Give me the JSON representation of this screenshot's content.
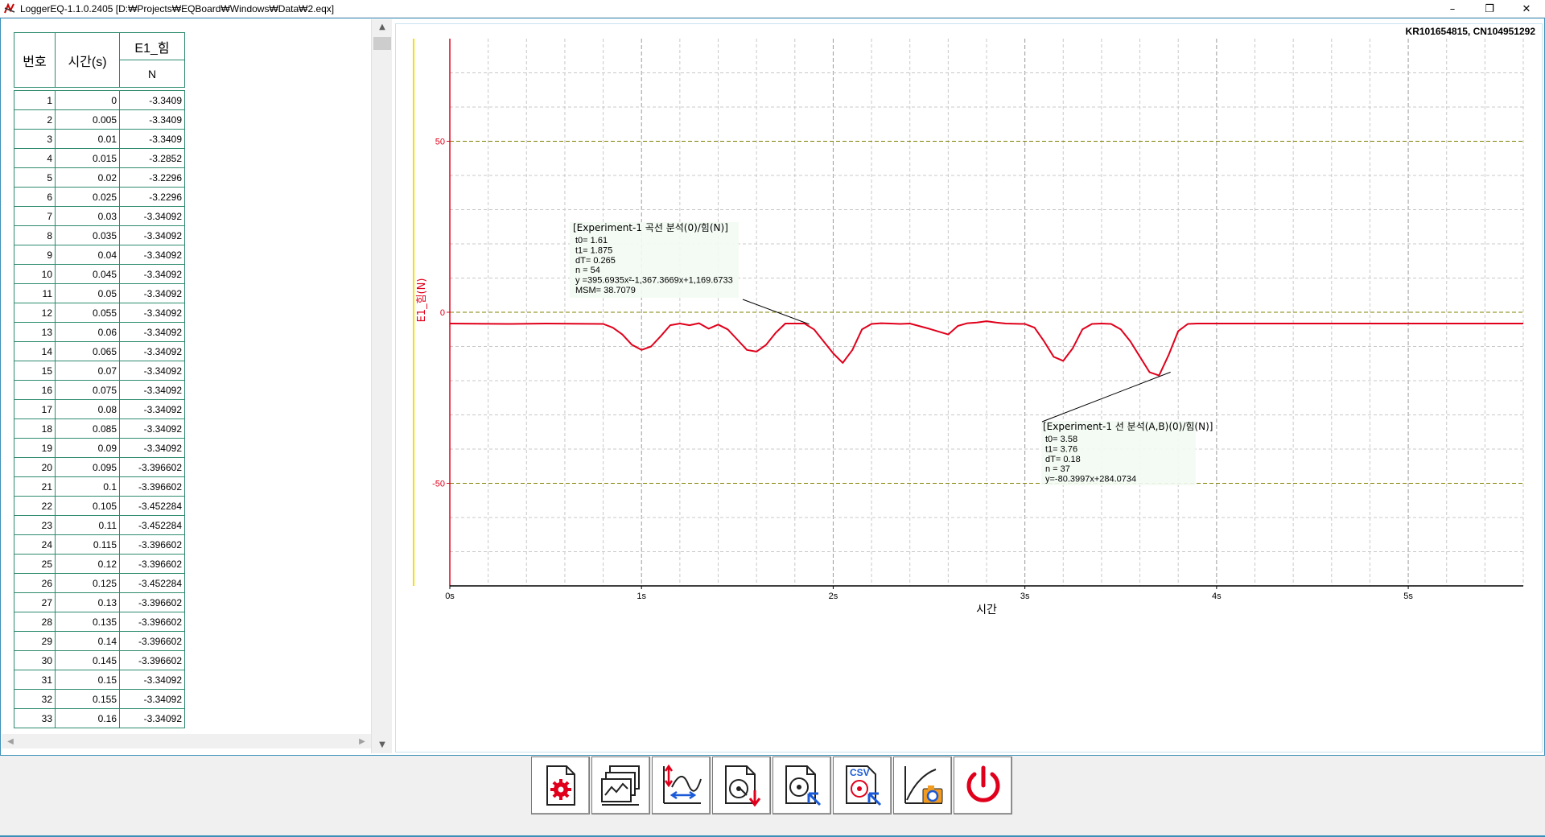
{
  "window": {
    "title": "LoggerEQ-1.1.0.2405  [D:₩Projects₩EQBoard₩Windows₩Data₩2.eqx]",
    "minimize": "–",
    "restore": "❐",
    "close": "✕"
  },
  "table": {
    "headers": {
      "no": "번호",
      "time": "시간(s)",
      "channel": "E1_힘",
      "unit": "N"
    },
    "rows": [
      [
        "1",
        "0",
        "-3.3409"
      ],
      [
        "2",
        "0.005",
        "-3.3409"
      ],
      [
        "3",
        "0.01",
        "-3.3409"
      ],
      [
        "4",
        "0.015",
        "-3.2852"
      ],
      [
        "5",
        "0.02",
        "-3.2296"
      ],
      [
        "6",
        "0.025",
        "-3.2296"
      ],
      [
        "7",
        "0.03",
        "-3.34092"
      ],
      [
        "8",
        "0.035",
        "-3.34092"
      ],
      [
        "9",
        "0.04",
        "-3.34092"
      ],
      [
        "10",
        "0.045",
        "-3.34092"
      ],
      [
        "11",
        "0.05",
        "-3.34092"
      ],
      [
        "12",
        "0.055",
        "-3.34092"
      ],
      [
        "13",
        "0.06",
        "-3.34092"
      ],
      [
        "14",
        "0.065",
        "-3.34092"
      ],
      [
        "15",
        "0.07",
        "-3.34092"
      ],
      [
        "16",
        "0.075",
        "-3.34092"
      ],
      [
        "17",
        "0.08",
        "-3.34092"
      ],
      [
        "18",
        "0.085",
        "-3.34092"
      ],
      [
        "19",
        "0.09",
        "-3.34092"
      ],
      [
        "20",
        "0.095",
        "-3.396602"
      ],
      [
        "21",
        "0.1",
        "-3.396602"
      ],
      [
        "22",
        "0.105",
        "-3.452284"
      ],
      [
        "23",
        "0.11",
        "-3.452284"
      ],
      [
        "24",
        "0.115",
        "-3.396602"
      ],
      [
        "25",
        "0.12",
        "-3.396602"
      ],
      [
        "26",
        "0.125",
        "-3.452284"
      ],
      [
        "27",
        "0.13",
        "-3.396602"
      ],
      [
        "28",
        "0.135",
        "-3.396602"
      ],
      [
        "29",
        "0.14",
        "-3.396602"
      ],
      [
        "30",
        "0.145",
        "-3.396602"
      ],
      [
        "31",
        "0.15",
        "-3.34092"
      ],
      [
        "32",
        "0.155",
        "-3.34092"
      ],
      [
        "33",
        "0.16",
        "-3.34092"
      ]
    ]
  },
  "chart": {
    "device_id": "KR101654815, CN104951292",
    "ylabel": "E1_힘(N)",
    "xlabel": "시간",
    "xticks": [
      "0s",
      "1s",
      "2s",
      "3s",
      "4s",
      "5s"
    ],
    "yticks": [
      "50",
      "0",
      "-50"
    ],
    "annotation1": {
      "title": "[Experiment-1 곡선 분석(0)/힘(N)]",
      "lines": [
        "t0= 1.61",
        "t1= 1.875",
        "dT= 0.265",
        "n = 54",
        "y =395.6935x²-1,367.3669x+1,169.6733",
        "MSM= 38.7079"
      ]
    },
    "annotation2": {
      "title": "[Experiment-1 선 분석(A,B)(0)/힘(N)]",
      "lines": [
        "t0= 3.58",
        "t1= 3.76",
        "dT= 0.18",
        "n = 37",
        "y=-80.3997x+284.0734"
      ]
    }
  },
  "chart_data": {
    "type": "line",
    "title": "",
    "xlabel": "시간",
    "ylabel": "E1_힘(N)",
    "xlim": [
      0,
      5.6
    ],
    "ylim": [
      -80,
      80
    ],
    "series": [
      {
        "name": "E1_힘",
        "color": "#e0001b",
        "x": [
          0,
          0.3,
          0.5,
          0.8,
          0.85,
          0.9,
          0.95,
          1.0,
          1.05,
          1.1,
          1.15,
          1.2,
          1.25,
          1.3,
          1.35,
          1.4,
          1.45,
          1.5,
          1.55,
          1.6,
          1.65,
          1.7,
          1.75,
          1.8,
          1.85,
          1.9,
          1.95,
          2.0,
          2.05,
          2.1,
          2.15,
          2.2,
          2.25,
          2.3,
          2.35,
          2.4,
          2.5,
          2.6,
          2.65,
          2.7,
          2.75,
          2.8,
          2.85,
          2.9,
          3.0,
          3.05,
          3.1,
          3.15,
          3.2,
          3.25,
          3.3,
          3.35,
          3.4,
          3.45,
          3.5,
          3.55,
          3.6,
          3.65,
          3.7,
          3.75,
          3.8,
          3.85,
          3.9,
          3.95,
          4.0,
          4.5,
          5.0,
          5.6
        ],
        "y": [
          -3.3,
          -3.4,
          -3.3,
          -3.4,
          -4.5,
          -6.5,
          -9.5,
          -11.0,
          -10.0,
          -7.0,
          -3.8,
          -3.3,
          -3.8,
          -3.2,
          -4.8,
          -3.6,
          -5.0,
          -8.0,
          -11.0,
          -11.5,
          -9.5,
          -6.0,
          -3.3,
          -3.3,
          -3.3,
          -5.0,
          -8.5,
          -12.0,
          -14.8,
          -11.0,
          -5.0,
          -3.4,
          -3.2,
          -3.3,
          -3.4,
          -3.3,
          -4.8,
          -6.5,
          -4.0,
          -3.2,
          -3.0,
          -2.6,
          -3.0,
          -3.3,
          -3.4,
          -4.5,
          -8.5,
          -13.0,
          -14.2,
          -10.5,
          -5.0,
          -3.4,
          -3.3,
          -3.4,
          -5.0,
          -8.5,
          -13.0,
          -17.5,
          -18.5,
          -12.5,
          -5.5,
          -3.4,
          -3.3,
          -3.3,
          -3.3,
          -3.3,
          -3.3,
          -3.3
        ]
      }
    ]
  },
  "toolbar": {
    "buttons": [
      {
        "name": "settings-button",
        "icon": "document-gear-icon"
      },
      {
        "name": "graph-view-button",
        "icon": "stacked-graphs-icon"
      },
      {
        "name": "axis-scale-button",
        "icon": "axis-arrows-icon"
      },
      {
        "name": "save-data-button",
        "icon": "disk-save-icon"
      },
      {
        "name": "open-data-button",
        "icon": "disk-open-icon"
      },
      {
        "name": "export-csv-button",
        "icon": "csv-export-icon"
      },
      {
        "name": "screenshot-button",
        "icon": "graph-camera-icon"
      },
      {
        "name": "power-button",
        "icon": "power-icon"
      }
    ],
    "labels": {
      "csv": "CSV"
    }
  }
}
